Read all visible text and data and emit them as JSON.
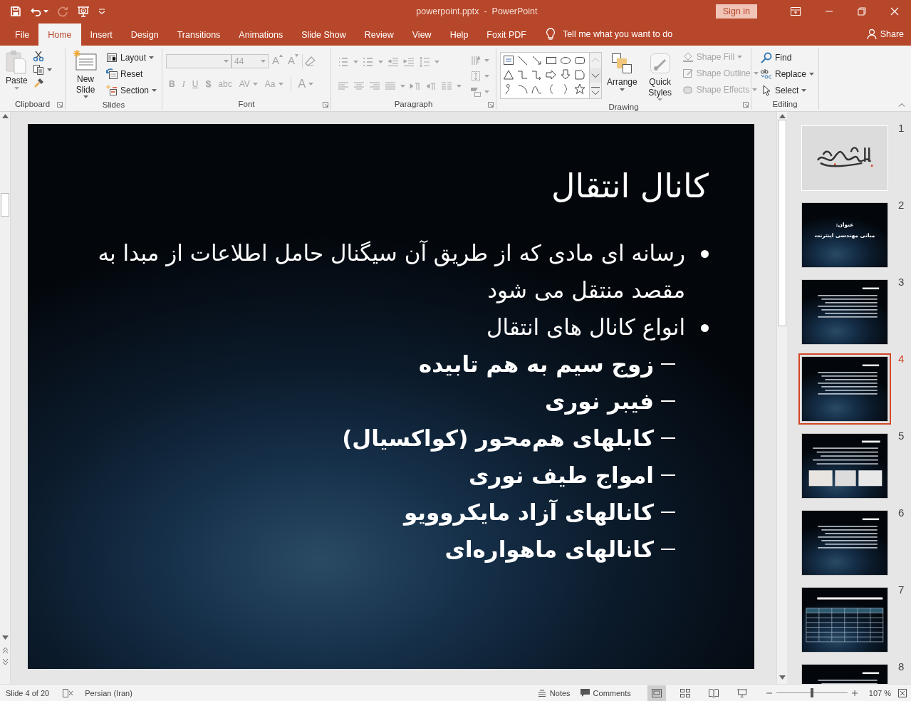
{
  "window": {
    "title": "powerpoint.pptx  -  PowerPoint",
    "sign_in": "Sign in"
  },
  "menu_tabs": [
    {
      "label": "File",
      "selected": false
    },
    {
      "label": "Home",
      "selected": true
    },
    {
      "label": "Insert",
      "selected": false
    },
    {
      "label": "Design",
      "selected": false
    },
    {
      "label": "Transitions",
      "selected": false
    },
    {
      "label": "Animations",
      "selected": false
    },
    {
      "label": "Slide Show",
      "selected": false
    },
    {
      "label": "Review",
      "selected": false
    },
    {
      "label": "View",
      "selected": false
    },
    {
      "label": "Help",
      "selected": false
    },
    {
      "label": "Foxit PDF",
      "selected": false
    }
  ],
  "tell_me": "Tell me what you want to do",
  "share": "Share",
  "ribbon": [
    {
      "kind": "clipboard",
      "label": "Clipboard",
      "dialog_launcher": true,
      "paste": {
        "label": "Paste",
        "disabled": true
      }
    },
    {
      "kind": "slides",
      "label": "Slides",
      "dialog_launcher": false,
      "new_slide": "New Slide",
      "commands": [
        {
          "kind": "layout",
          "label": "Layout",
          "dropdown": true
        },
        {
          "kind": "reset",
          "label": "Reset",
          "dropdown": false
        },
        {
          "kind": "section",
          "label": "Section",
          "dropdown": true
        }
      ]
    },
    {
      "kind": "font",
      "label": "Font",
      "dialog_launcher": true,
      "disabled": true,
      "font_size": "44",
      "size_buttons": [
        {
          "kind": "grow",
          "label": "A"
        },
        {
          "kind": "shrink",
          "label": "A"
        }
      ],
      "format_buttons": [
        {
          "kind": "bold",
          "label": "B",
          "dropdown": false
        },
        {
          "kind": "italic",
          "label": "I",
          "dropdown": false
        },
        {
          "kind": "underline",
          "label": "U",
          "dropdown": false
        },
        {
          "kind": "shadow",
          "label": "S",
          "dropdown": false
        },
        {
          "kind": "strike",
          "label": "abc",
          "dropdown": false
        },
        {
          "kind": "spacing",
          "label": "AV",
          "dropdown": true
        },
        {
          "kind": "case",
          "label": "Aa",
          "dropdown": true
        },
        {
          "kind": "color",
          "label": "A",
          "dropdown": true
        }
      ]
    },
    {
      "kind": "paragraph",
      "label": "Paragraph",
      "dialog_launcher": true,
      "disabled": true
    },
    {
      "kind": "drawing",
      "label": "Drawing",
      "dialog_launcher": true,
      "arrange": "Arrange",
      "quick_styles": {
        "label": "Quick Styles",
        "disabled": true
      },
      "commands": [
        {
          "kind": "fill",
          "label": "Shape Fill",
          "disabled": true
        },
        {
          "kind": "outline",
          "label": "Shape Outline",
          "disabled": true
        },
        {
          "kind": "effects",
          "label": "Shape Effects",
          "disabled": true
        }
      ]
    },
    {
      "kind": "editing",
      "label": "Editing",
      "dialog_launcher": false,
      "commands": [
        {
          "kind": "find",
          "label": "Find",
          "dropdown": false
        },
        {
          "kind": "replace",
          "label": "Replace",
          "dropdown": true
        },
        {
          "kind": "select",
          "label": "Select",
          "dropdown": true
        }
      ]
    }
  ],
  "slide": {
    "title": "کانال انتقال",
    "bullets": [
      {
        "text": "رسانه ای مادی که از طریق آن سیگنال حامل اطلاعات از مبدا به مقصد منتقل می شود"
      },
      {
        "text": "انواع کانال های انتقال",
        "children": [
          {
            "text": "زوج سیم به هم تابیده"
          },
          {
            "text": "فیبر نوری"
          },
          {
            "text": "کابلهای هم‌محور (کواکسیال)"
          },
          {
            "text": "امواج طیف نوری"
          },
          {
            "text": "کانالهای آزاد مایکروویو"
          },
          {
            "text": "کانالهای ماهواره‌ای"
          }
        ]
      }
    ]
  },
  "thumbnails": [
    {
      "number": "1",
      "kind": "calligraphy",
      "selected": false
    },
    {
      "number": "2",
      "kind": "title",
      "selected": false,
      "lines": [
        "عنوان:",
        "مبانی مهندسی اینترنت"
      ]
    },
    {
      "number": "3",
      "kind": "text",
      "selected": false
    },
    {
      "number": "4",
      "kind": "text",
      "selected": true
    },
    {
      "number": "5",
      "kind": "images",
      "selected": false
    },
    {
      "number": "6",
      "kind": "text",
      "selected": false
    },
    {
      "number": "7",
      "kind": "table",
      "selected": false
    },
    {
      "number": "8",
      "kind": "text",
      "selected": false
    }
  ],
  "status_bar": {
    "slide_count": "Slide 4 of 20",
    "language": "Persian (Iran)",
    "notes": "Notes",
    "comments": "Comments",
    "views": [
      {
        "kind": "normal",
        "selected": true
      },
      {
        "kind": "sorter",
        "selected": false
      },
      {
        "kind": "reading",
        "selected": false
      },
      {
        "kind": "show",
        "selected": false
      }
    ],
    "zoom": {
      "level": 0.5,
      "reading": "107 %"
    }
  }
}
